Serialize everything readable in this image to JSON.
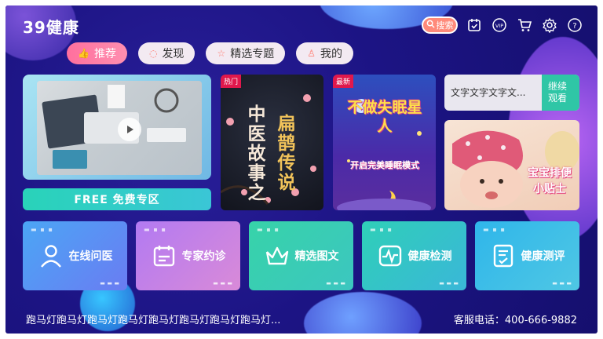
{
  "header": {
    "logo": "39健康",
    "search_label": "搜索",
    "icons": [
      "calendar-check-icon",
      "vip-icon",
      "cart-icon",
      "settings-icon",
      "help-icon"
    ],
    "vip_text": "VIP",
    "help_text": "?"
  },
  "tabs": [
    {
      "label": "推荐",
      "icon": "thumbs-up-icon",
      "active": true
    },
    {
      "label": "发现",
      "icon": "chat-bubble-icon",
      "active": false
    },
    {
      "label": "精选专题",
      "icon": "star-icon",
      "active": false
    },
    {
      "label": "我的",
      "icon": "user-icon",
      "active": false
    }
  ],
  "featured": {
    "free_zone_label": "FREE  免费专区"
  },
  "posters": [
    {
      "tag": "热门",
      "title_a": "中医故事之",
      "title_b": "扁鹊传说"
    },
    {
      "tag": "最新",
      "title_a": "不做失眠星人",
      "subtitle": "开启完美睡眠模式"
    }
  ],
  "text_card": {
    "text": "文字文字文字文...",
    "continue_label": "继续观看"
  },
  "baby_card": {
    "caption_line1": "宝宝排便",
    "caption_line2": "小贴士"
  },
  "tiles": [
    {
      "label": "在线问医",
      "icon": "doctor-icon"
    },
    {
      "label": "专家约诊",
      "icon": "appointment-icon"
    },
    {
      "label": "精选图文",
      "icon": "crown-icon"
    },
    {
      "label": "健康检测",
      "icon": "heartbeat-icon"
    },
    {
      "label": "健康测评",
      "icon": "assessment-icon"
    }
  ],
  "footer": {
    "marquee": "跑马灯跑马灯跑马灯跑马灯跑马灯跑马灯跑马灯跑马灯...",
    "hotline": "客服电话：400-666-9882"
  },
  "colors": {
    "background": "#1c1484",
    "accent_pink": "#ff6f9d",
    "accent_green": "#2fc6a6",
    "search_orange": "#ff8a7a"
  }
}
